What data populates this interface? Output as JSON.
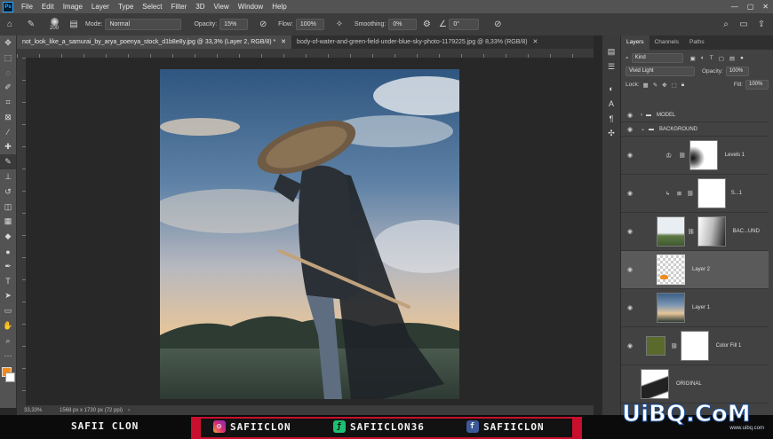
{
  "menubar": {
    "items": [
      "File",
      "Edit",
      "Image",
      "Layer",
      "Type",
      "Select",
      "Filter",
      "3D",
      "View",
      "Window",
      "Help"
    ]
  },
  "options": {
    "brush_size": "200",
    "mode_label": "Mode:",
    "mode_value": "Normal",
    "opacity_label": "Opacity:",
    "opacity_value": "15%",
    "flow_label": "Flow:",
    "flow_value": "100%",
    "smoothing_label": "Smoothing:",
    "smoothing_value": "0%",
    "angle_value": "0°"
  },
  "documents": {
    "tabs": [
      {
        "label": "not_look_like_a_samurai_by_arya_poenya_stock_d1b8e8y.jpg @ 33,3% (Layer 2, RGB/8) *"
      },
      {
        "label": "body-of-water-and-green-field-under-blue-sky-photo-1179225.jpg @ 8,33% (RGB/8)"
      }
    ]
  },
  "status": {
    "zoom": "33,33%",
    "info": "1568 px x 1730 px (72 ppi)"
  },
  "layers_panel": {
    "tabs": [
      "Layers",
      "Channels",
      "Paths"
    ],
    "kind_label": "Kind",
    "blend_mode": "Vivid Light",
    "opacity_label": "Opacity:",
    "opacity_value": "100%",
    "lock_label": "Lock:",
    "fill_label": "Fill:",
    "fill_value": "100%",
    "groups": [
      "MODEL",
      "BACKGROUND"
    ],
    "layers": [
      {
        "name": "Levels 1"
      },
      {
        "name": "S...1"
      },
      {
        "name": "BAC...UND"
      },
      {
        "name": "Layer 2"
      },
      {
        "name": "Layer 1"
      },
      {
        "name": "Color Fill 1"
      },
      {
        "name": "ORIGINAL"
      }
    ]
  },
  "overlay": {
    "channel": "SAFII CLON",
    "instagram": "SAFIICLON",
    "fiverr": "SAFIICLON36",
    "facebook": "SAFIICLON",
    "watermark": "UiBQ.CoM",
    "watermark_sub": "www.uibq.com"
  }
}
